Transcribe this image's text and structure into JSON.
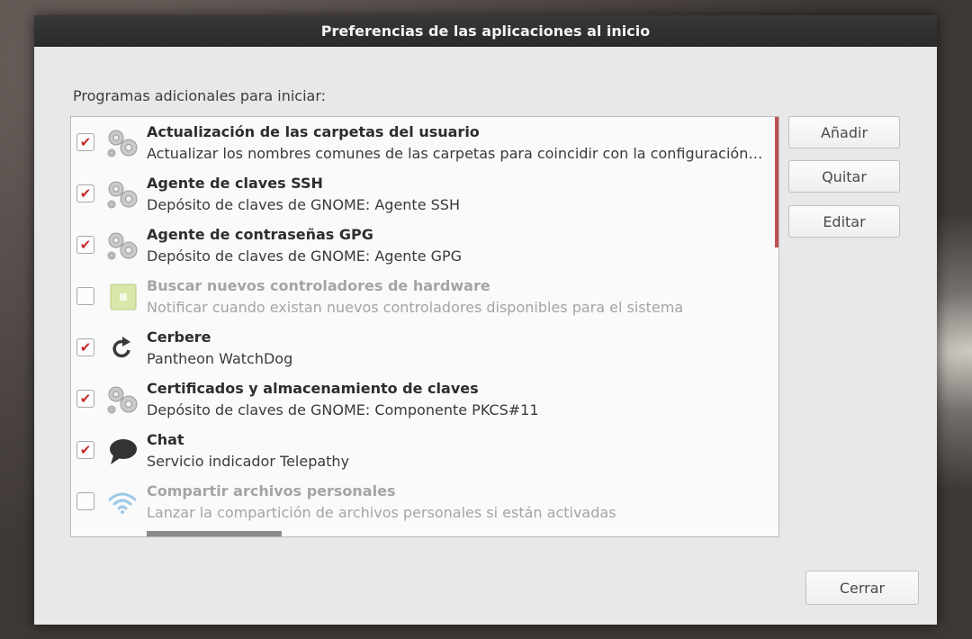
{
  "window": {
    "title": "Preferencias de las aplicaciones al inicio"
  },
  "section_label": "Programas adicionales para iniciar:",
  "programs": [
    {
      "checked": true,
      "icon": "gears-icon",
      "name": "Actualización de las carpetas del usuario",
      "description": "Actualizar los nombres comunes de las carpetas para coincidir con la configuración…"
    },
    {
      "checked": true,
      "icon": "gears-icon",
      "name": "Agente de claves SSH",
      "description": "Depósito de claves de GNOME: Agente SSH"
    },
    {
      "checked": true,
      "icon": "gears-icon",
      "name": "Agente de contraseñas GPG",
      "description": "Depósito de claves de GNOME: Agente GPG"
    },
    {
      "checked": false,
      "icon": "hardware-chip-icon",
      "name": "Buscar nuevos controladores de hardware",
      "description": "Notificar cuando existan nuevos controladores disponibles para el sistema"
    },
    {
      "checked": true,
      "icon": "refresh-icon",
      "name": "Cerbere",
      "description": "Pantheon WatchDog"
    },
    {
      "checked": true,
      "icon": "gears-icon",
      "name": "Certificados y almacenamiento de claves",
      "description": "Depósito de claves de GNOME: Componente PKCS#11"
    },
    {
      "checked": true,
      "icon": "chat-bubble-icon",
      "name": "Chat",
      "description": "Servicio indicador  Telepathy"
    },
    {
      "checked": false,
      "icon": "wifi-icon",
      "name": "Compartir archivos personales",
      "description": "Lanzar la compartición de archivos personales si están activadas"
    }
  ],
  "buttons": {
    "add": "Añadir",
    "remove": "Quitar",
    "edit": "Editar",
    "close": "Cerrar"
  },
  "colors": {
    "check_mark": "#c82a2a",
    "scroll_indicator": "#c05050",
    "titlebar": "#2f2f2f"
  }
}
